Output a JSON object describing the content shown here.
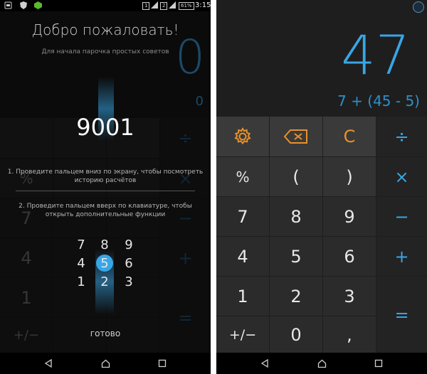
{
  "left_screen": {
    "status_bar": {
      "left_icons": [
        "app-icon",
        "shield-icon",
        "android-icon"
      ],
      "right_icons": [
        "sim1-icon",
        "signal-icon",
        "sim2-icon",
        "signal-icon",
        "battery-icon"
      ],
      "sim1": "1",
      "sim2": "2",
      "battery": "61%",
      "time": "3:15"
    },
    "onboarding": {
      "title": "Добро пожаловать!",
      "subtitle": "Для начала парочка простых советов",
      "demo_number": "9001",
      "tip1": "1. Проведите пальцем вниз по экрану, чтобы посмотреть историю расчётов",
      "tip2": "2. Проведите пальцем вверх по клавиатуре, чтобы открыть дополнительные функции",
      "done_label": "готово",
      "mini_keys": [
        "7",
        "8",
        "9",
        "4",
        "5",
        "6",
        "1",
        "2",
        "3"
      ],
      "highlight_color": "#38a6e6"
    },
    "ghost": {
      "display": "0",
      "display_small": "0",
      "divide": "÷",
      "percent": "%",
      "times": "×",
      "seven": "7",
      "minus": "−",
      "four": "4",
      "plus": "+",
      "one": "1",
      "equals": "=",
      "plusminus": "+/−"
    }
  },
  "right_screen": {
    "display": {
      "result": "47",
      "expression": "7 + (45 - 5)"
    },
    "keys": {
      "settings_icon": "gear-icon",
      "backspace_icon": "backspace-icon",
      "clear": "C",
      "divide": "÷",
      "percent": "%",
      "open_paren": "(",
      "close_paren": ")",
      "multiply": "×",
      "seven": "7",
      "eight": "8",
      "nine": "9",
      "minus": "−",
      "four": "4",
      "five": "5",
      "six": "6",
      "plus": "+",
      "one": "1",
      "two": "2",
      "three": "3",
      "equals": "=",
      "plusminus": "+/−",
      "zero": "0",
      "comma": ","
    },
    "colors": {
      "accent": "#38a6e6",
      "orange": "#e8912a"
    }
  },
  "nav": {
    "back_icon": "back-icon",
    "home_icon": "home-icon",
    "recents_icon": "recents-icon"
  }
}
